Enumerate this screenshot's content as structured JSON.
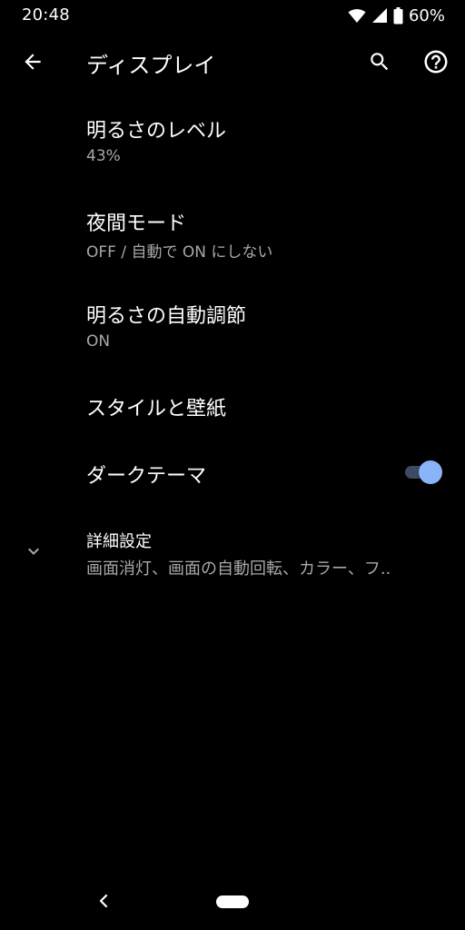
{
  "status_bar": {
    "time": "20:48",
    "battery_percent": "60%",
    "icons": [
      "wifi-icon",
      "signal-icon",
      "battery-icon"
    ]
  },
  "app_bar": {
    "title": "ディスプレイ",
    "back_icon": "arrow-back-icon",
    "search_icon": "search-icon",
    "help_icon": "help-circle-icon"
  },
  "settings": {
    "brightness": {
      "title": "明るさのレベル",
      "summary": "43%"
    },
    "night_mode": {
      "title": "夜間モード",
      "summary": "OFF / 自動で ON にしない"
    },
    "adaptive_brightness": {
      "title": "明るさの自動調節",
      "summary": "ON"
    },
    "style_wallpaper": {
      "title": "スタイルと壁紙"
    },
    "dark_theme": {
      "title": "ダークテーマ",
      "enabled": true
    },
    "advanced": {
      "title": "詳細設定",
      "summary": "画面消灯、画面の自動回転、カラー、フ..",
      "icon": "chevron-down-icon"
    }
  },
  "nav_bar": {
    "back_icon": "nav-back-icon",
    "home_icon": "home-pill-icon"
  },
  "colors": {
    "background": "#000000",
    "text_primary": "#ffffff",
    "text_secondary": "#a8a8a8",
    "toggle_thumb": "#8ab4f8",
    "toggle_track": "#3c4a63"
  }
}
